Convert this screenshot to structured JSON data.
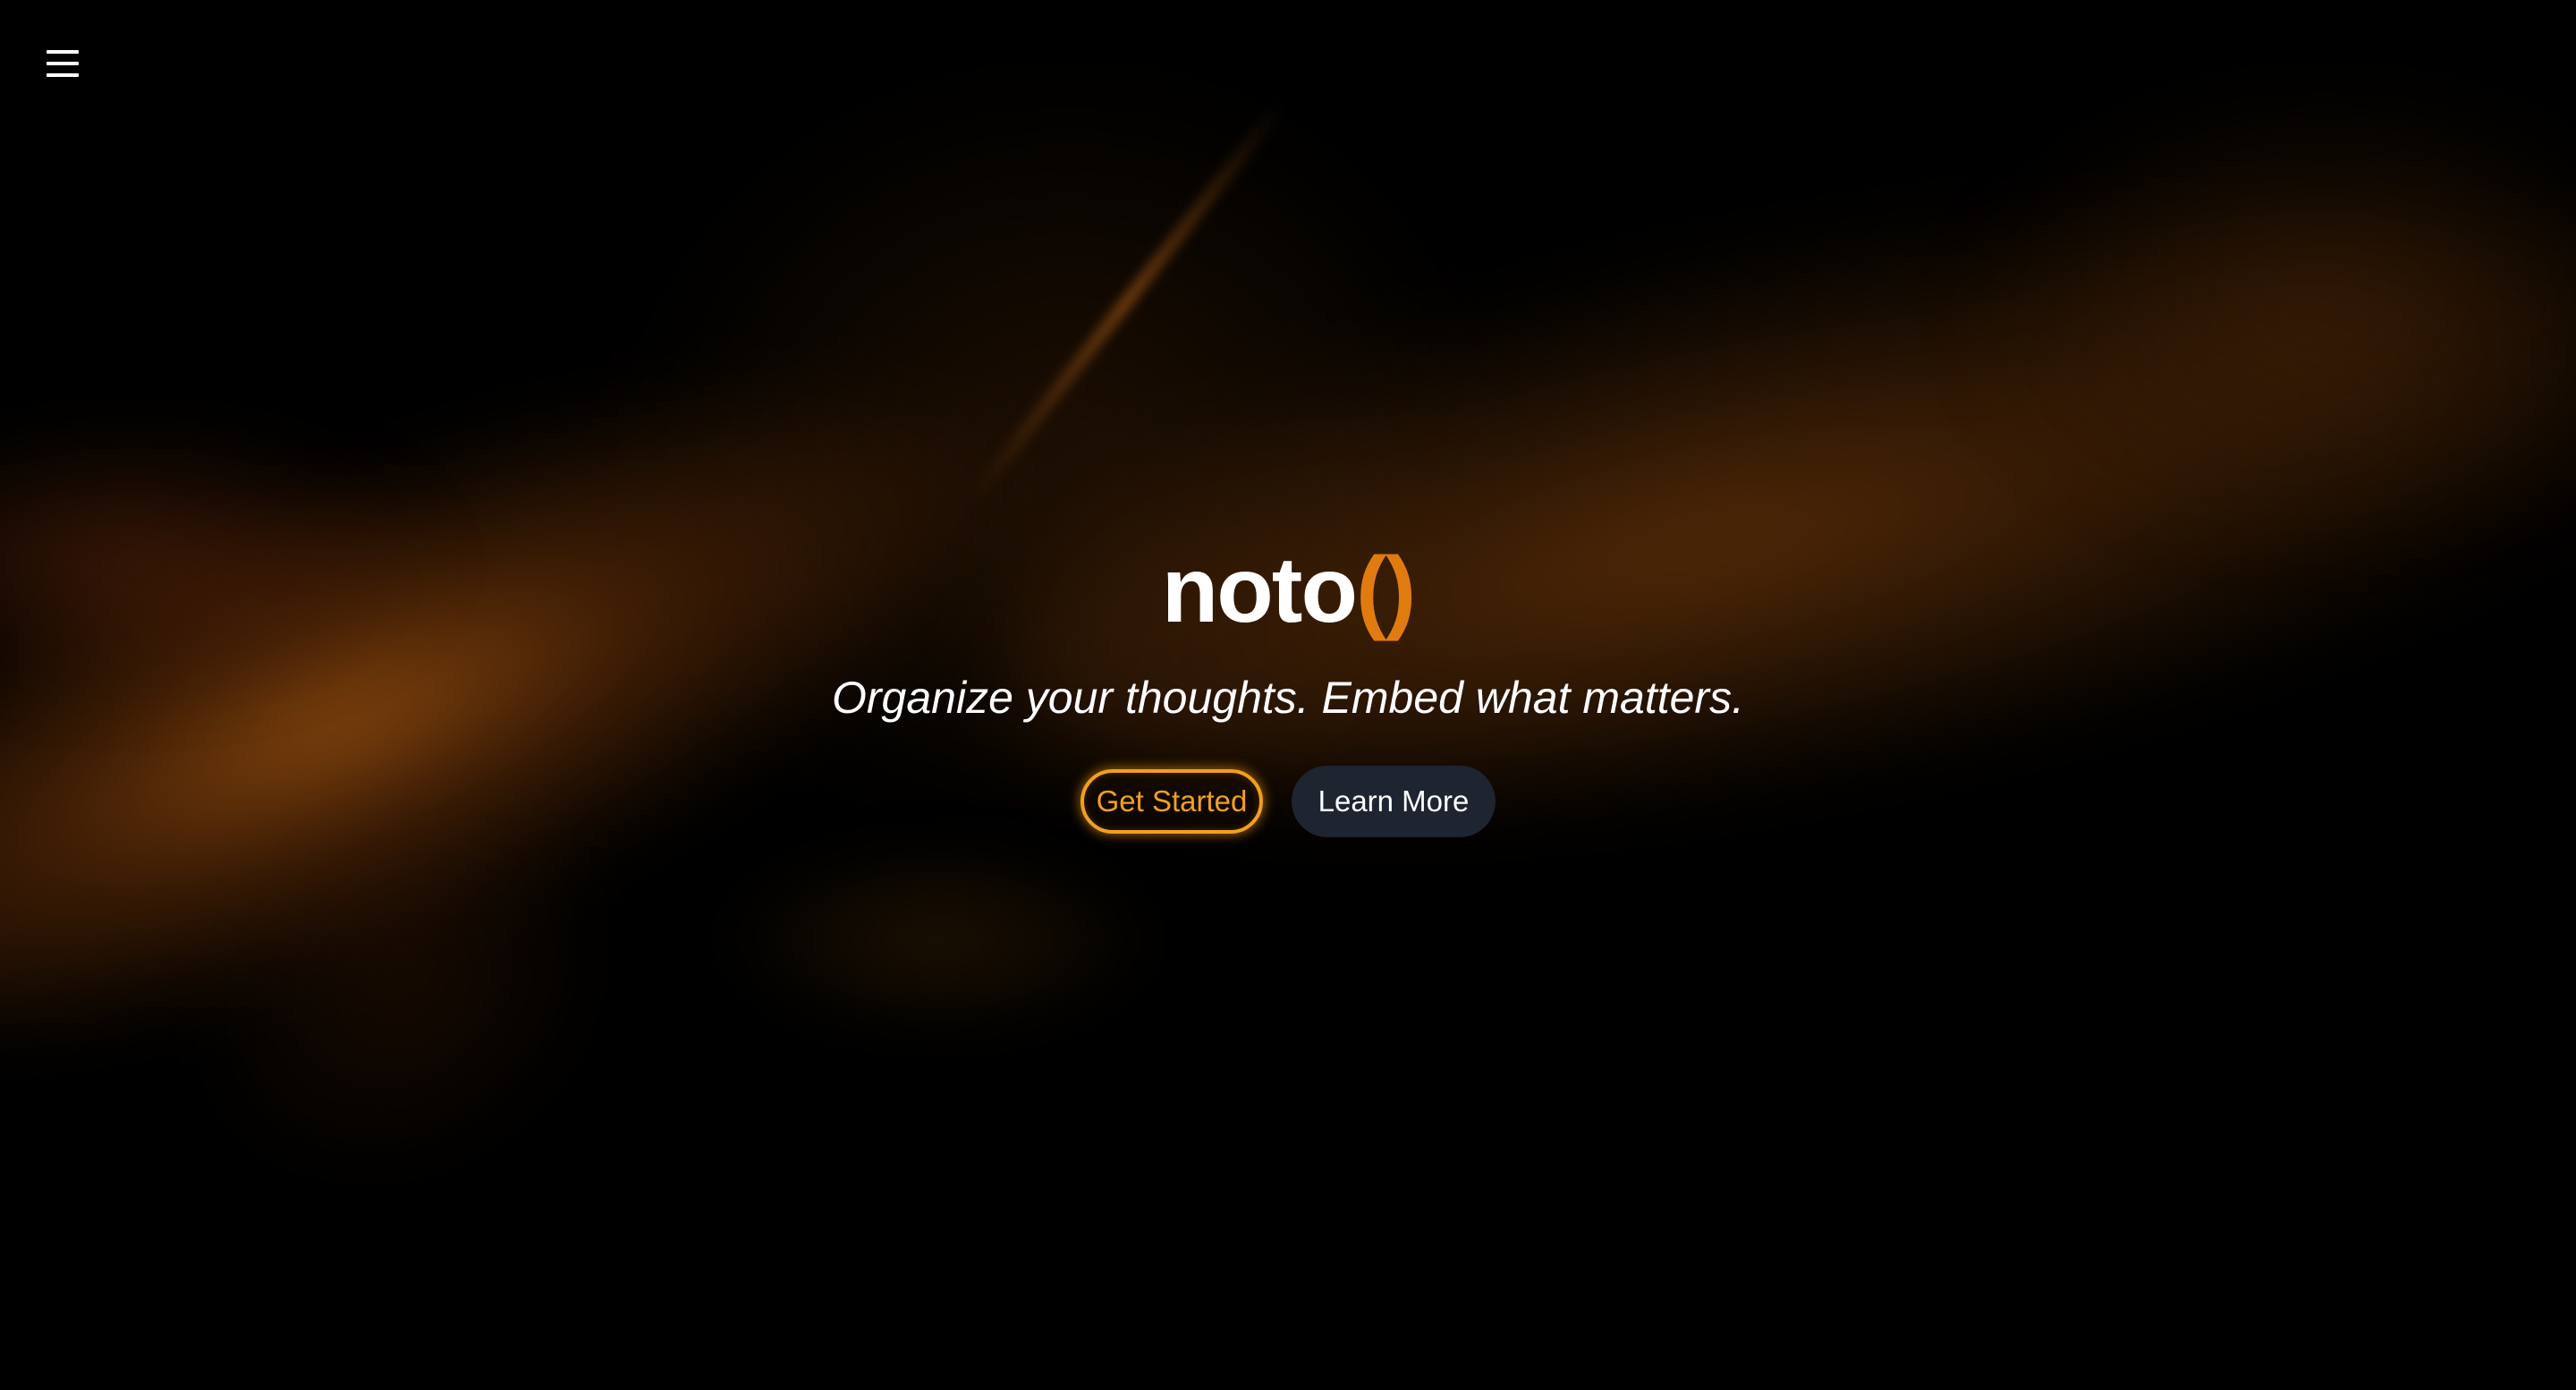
{
  "nav": {
    "menu_icon": "hamburger-menu-icon"
  },
  "hero": {
    "logo_text": "noto",
    "logo_suffix": "()",
    "tagline": "Organize your thoughts. Embed what matters.",
    "primary_button_label": "Get Started",
    "secondary_button_label": "Learn More"
  },
  "colors": {
    "background": "#000000",
    "accent": "#e07c0f",
    "primary_button": "#f0a020",
    "secondary_button_bg": "#1e2430",
    "text": "#ffffff"
  }
}
